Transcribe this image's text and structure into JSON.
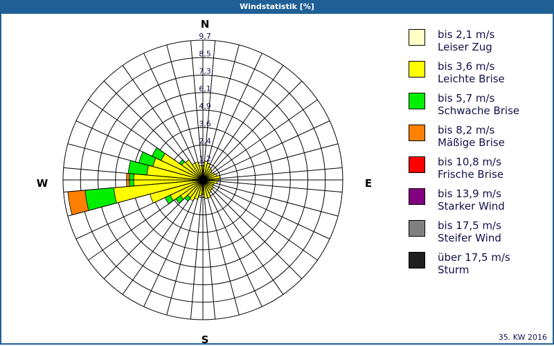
{
  "title": "Windstatistik [%]",
  "footer": "35. KW 2016",
  "chart_data": {
    "type": "wind-rose",
    "title": "Windstatistik [%]",
    "compass": {
      "N": "N",
      "E": "E",
      "S": "S",
      "W": "W"
    },
    "ring_labels": [
      "1,2",
      "2,4",
      "3,6",
      "4,9",
      "6,1",
      "7,3",
      "8,5",
      "9,7"
    ],
    "rmax": 9.7,
    "sector_width_deg": 10,
    "classes": [
      {
        "label": "bis 2,1 m/s",
        "name": "Leiser Zug",
        "color": "#ffffc8"
      },
      {
        "label": "bis 3,6 m/s",
        "name": "Leichte Brise",
        "color": "#ffff00"
      },
      {
        "label": "bis 5,7 m/s",
        "name": "Schwache Brise",
        "color": "#00f000"
      },
      {
        "label": "bis 8,2 m/s",
        "name": "Mäßige Brise",
        "color": "#ff8000"
      },
      {
        "label": "bis 10,8 m/s",
        "name": "Frische Brise",
        "color": "#ff0000"
      },
      {
        "label": "bis 13,9 m/s",
        "name": "Starker Wind",
        "color": "#800080"
      },
      {
        "label": "bis 17,5 m/s",
        "name": "Steifer Wind",
        "color": "#808080"
      },
      {
        "label": "über 17,5 m/s",
        "name": "Sturm",
        "color": "#202020"
      }
    ],
    "sectors": [
      {
        "dir": 0,
        "values": [
          0.2,
          0.8,
          0,
          0
        ]
      },
      {
        "dir": 10,
        "values": [
          0.2,
          1.1,
          0,
          0
        ]
      },
      {
        "dir": 20,
        "values": [
          0.2,
          1.0,
          0,
          0
        ]
      },
      {
        "dir": 30,
        "values": [
          0.2,
          0.8,
          0,
          0
        ]
      },
      {
        "dir": 40,
        "values": [
          0.2,
          0.7,
          0,
          0
        ]
      },
      {
        "dir": 50,
        "values": [
          0.2,
          0.6,
          0,
          0
        ]
      },
      {
        "dir": 60,
        "values": [
          0.2,
          0.7,
          0,
          0
        ]
      },
      {
        "dir": 70,
        "values": [
          0.2,
          0.8,
          0,
          0
        ]
      },
      {
        "dir": 80,
        "values": [
          0.2,
          1.0,
          0,
          0
        ]
      },
      {
        "dir": 90,
        "values": [
          0.2,
          0.9,
          0,
          0
        ]
      },
      {
        "dir": 100,
        "values": [
          0.2,
          0.8,
          0,
          0
        ]
      },
      {
        "dir": 110,
        "values": [
          0.2,
          0.6,
          0,
          0
        ]
      },
      {
        "dir": 120,
        "values": [
          0.2,
          0.6,
          0,
          0
        ]
      },
      {
        "dir": 130,
        "values": [
          0.2,
          0.7,
          0,
          0
        ]
      },
      {
        "dir": 140,
        "values": [
          0.2,
          0.7,
          0,
          0
        ]
      },
      {
        "dir": 150,
        "values": [
          0.2,
          0.8,
          0,
          0
        ]
      },
      {
        "dir": 160,
        "values": [
          0.2,
          1.1,
          0,
          0
        ]
      },
      {
        "dir": 170,
        "values": [
          0.2,
          1.1,
          0,
          0
        ]
      },
      {
        "dir": 180,
        "values": [
          0.2,
          0.8,
          0,
          0
        ]
      },
      {
        "dir": 190,
        "values": [
          0.2,
          0.9,
          0,
          0
        ]
      },
      {
        "dir": 200,
        "values": [
          0.2,
          1.2,
          0,
          0
        ]
      },
      {
        "dir": 210,
        "values": [
          0.2,
          1.4,
          0,
          0
        ]
      },
      {
        "dir": 220,
        "values": [
          0.2,
          1.3,
          0.3,
          0
        ]
      },
      {
        "dir": 230,
        "values": [
          0.2,
          1.7,
          0.4,
          0
        ]
      },
      {
        "dir": 240,
        "values": [
          0.2,
          2.3,
          0.4,
          0
        ]
      },
      {
        "dir": 250,
        "values": [
          0.2,
          3.6,
          0,
          0
        ]
      },
      {
        "dir": 260,
        "values": [
          0.2,
          6.0,
          2.0,
          1.2
        ]
      },
      {
        "dir": 270,
        "values": [
          0.2,
          4.6,
          0.3,
          0.2
        ]
      },
      {
        "dir": 280,
        "values": [
          0.2,
          3.7,
          1.3,
          0
        ]
      },
      {
        "dir": 290,
        "values": [
          0.2,
          3.4,
          1.0,
          0
        ]
      },
      {
        "dir": 300,
        "values": [
          0.2,
          3.0,
          0.7,
          0
        ]
      },
      {
        "dir": 310,
        "values": [
          0.2,
          1.6,
          0.2,
          0
        ]
      },
      {
        "dir": 320,
        "values": [
          0.2,
          1.5,
          0,
          0
        ]
      },
      {
        "dir": 330,
        "values": [
          0.2,
          1.1,
          0,
          0
        ]
      },
      {
        "dir": 340,
        "values": [
          0.2,
          1.1,
          0,
          0
        ]
      },
      {
        "dir": 350,
        "values": [
          0.2,
          0.8,
          0,
          0
        ]
      }
    ]
  }
}
